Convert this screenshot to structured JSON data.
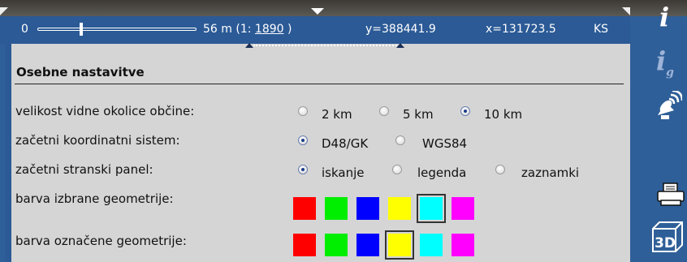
{
  "statusbar": {
    "scale_min": "0",
    "scale_text": "56 m (1:",
    "scale_ratio": "1890",
    "scale_close": ")",
    "y_coord": "y=388441.9",
    "x_coord": "x=131723.5",
    "crs_code": "KS"
  },
  "panel": {
    "title": "Osebne nastavitve",
    "rows": [
      {
        "label": "velikost vidne okolice občine:",
        "options": [
          "2 km",
          "5 km",
          "10 km"
        ],
        "selected": "10 km"
      },
      {
        "label": "začetni koordinatni sistem:",
        "options": [
          "D48/GK",
          "WGS84"
        ],
        "selected": "D48/GK"
      },
      {
        "label": "začetni stranski panel:",
        "options": [
          "iskanje",
          "legenda",
          "zaznamki"
        ],
        "selected": "iskanje"
      },
      {
        "label": "barva izbrane geometrije:",
        "colors": [
          "#ff0000",
          "#00ee00",
          "#0000ff",
          "#ffff00",
          "#00ffff",
          "#ff00ff"
        ],
        "selected": "#00ffff"
      },
      {
        "label": "barva označene geometrije:",
        "colors": [
          "#ff0000",
          "#00ee00",
          "#0000ff",
          "#ffff00",
          "#00ffff",
          "#ff00ff"
        ],
        "selected": "#ffff00"
      }
    ]
  },
  "sidebar": {
    "icons": [
      "info-icon",
      "info-gps-icon",
      "satellite-dish-icon",
      "printer-icon",
      "3d-icon"
    ],
    "info_glyph": "i",
    "infog_glyph": "i",
    "infog_sub": "g",
    "threed_label": "3D"
  },
  "colors": {
    "accent": "#2b5a96",
    "panel": "#d5d5d5"
  }
}
